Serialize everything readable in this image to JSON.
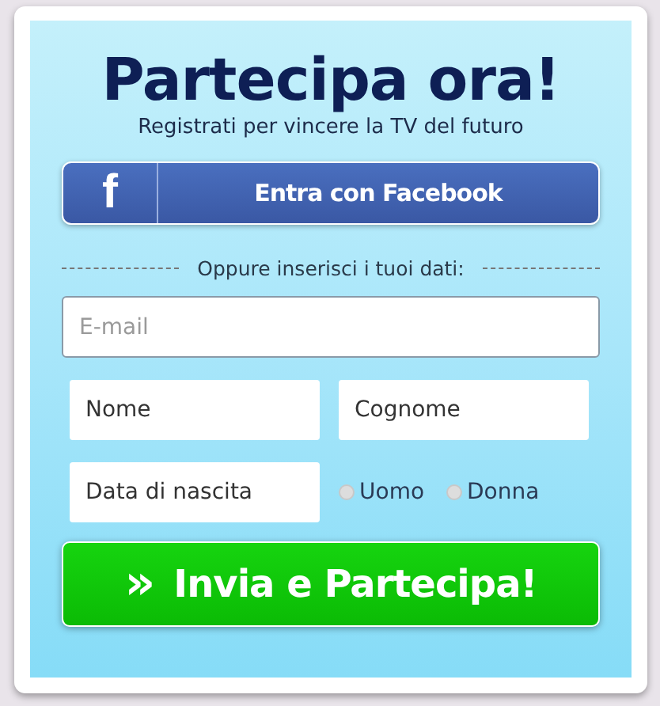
{
  "title": "Partecipa ora!",
  "subtitle": "Registrati per vincere la TV del futuro",
  "facebook_button": {
    "icon": "f",
    "label": "Entra con Facebook"
  },
  "divider_text": "Oppure inserisci i tuoi dati:",
  "email_field": {
    "placeholder": "E-mail"
  },
  "name_fields": [
    {
      "placeholder": "Nome"
    },
    {
      "placeholder": "Cognome"
    }
  ],
  "birthdate_field": {
    "placeholder": "Data di nascita"
  },
  "gender_options": [
    {
      "label": "Uomo",
      "selected": false
    },
    {
      "label": "Donna",
      "selected": false
    }
  ],
  "submit_button": {
    "icon": "»",
    "label": "Invia e Partecipa!"
  }
}
